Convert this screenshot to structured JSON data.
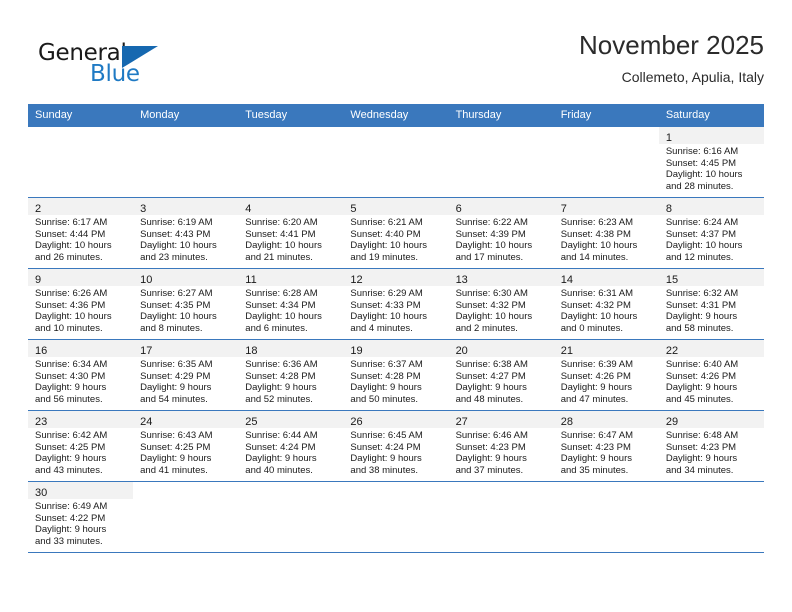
{
  "brand": {
    "name_top": "General",
    "name_bottom": "Blue",
    "accent_color": "#1668b0",
    "text_color": "#1a1a1a"
  },
  "header": {
    "title": "November 2025",
    "subtitle": "Collemeto, Apulia, Italy"
  },
  "theme": {
    "header_bg": "#3a78bd",
    "header_text": "#ffffff",
    "daynum_bg": "#f2f2f2",
    "grid_line": "#3a78bd"
  },
  "weekdays": [
    "Sunday",
    "Monday",
    "Tuesday",
    "Wednesday",
    "Thursday",
    "Friday",
    "Saturday"
  ],
  "labels": {
    "sunrise_prefix": "Sunrise:",
    "sunset_prefix": "Sunset:",
    "daylight_prefix": "Daylight:"
  },
  "weeks": [
    [
      {
        "day": "",
        "empty": true
      },
      {
        "day": "",
        "empty": true
      },
      {
        "day": "",
        "empty": true
      },
      {
        "day": "",
        "empty": true
      },
      {
        "day": "",
        "empty": true
      },
      {
        "day": "",
        "empty": true
      },
      {
        "day": "1",
        "sunrise": "Sunrise: 6:16 AM",
        "sunset": "Sunset: 4:45 PM",
        "daylight_line1": "Daylight: 10 hours",
        "daylight_line2": "and 28 minutes."
      }
    ],
    [
      {
        "day": "2",
        "sunrise": "Sunrise: 6:17 AM",
        "sunset": "Sunset: 4:44 PM",
        "daylight_line1": "Daylight: 10 hours",
        "daylight_line2": "and 26 minutes."
      },
      {
        "day": "3",
        "sunrise": "Sunrise: 6:19 AM",
        "sunset": "Sunset: 4:43 PM",
        "daylight_line1": "Daylight: 10 hours",
        "daylight_line2": "and 23 minutes."
      },
      {
        "day": "4",
        "sunrise": "Sunrise: 6:20 AM",
        "sunset": "Sunset: 4:41 PM",
        "daylight_line1": "Daylight: 10 hours",
        "daylight_line2": "and 21 minutes."
      },
      {
        "day": "5",
        "sunrise": "Sunrise: 6:21 AM",
        "sunset": "Sunset: 4:40 PM",
        "daylight_line1": "Daylight: 10 hours",
        "daylight_line2": "and 19 minutes."
      },
      {
        "day": "6",
        "sunrise": "Sunrise: 6:22 AM",
        "sunset": "Sunset: 4:39 PM",
        "daylight_line1": "Daylight: 10 hours",
        "daylight_line2": "and 17 minutes."
      },
      {
        "day": "7",
        "sunrise": "Sunrise: 6:23 AM",
        "sunset": "Sunset: 4:38 PM",
        "daylight_line1": "Daylight: 10 hours",
        "daylight_line2": "and 14 minutes."
      },
      {
        "day": "8",
        "sunrise": "Sunrise: 6:24 AM",
        "sunset": "Sunset: 4:37 PM",
        "daylight_line1": "Daylight: 10 hours",
        "daylight_line2": "and 12 minutes."
      }
    ],
    [
      {
        "day": "9",
        "sunrise": "Sunrise: 6:26 AM",
        "sunset": "Sunset: 4:36 PM",
        "daylight_line1": "Daylight: 10 hours",
        "daylight_line2": "and 10 minutes."
      },
      {
        "day": "10",
        "sunrise": "Sunrise: 6:27 AM",
        "sunset": "Sunset: 4:35 PM",
        "daylight_line1": "Daylight: 10 hours",
        "daylight_line2": "and 8 minutes."
      },
      {
        "day": "11",
        "sunrise": "Sunrise: 6:28 AM",
        "sunset": "Sunset: 4:34 PM",
        "daylight_line1": "Daylight: 10 hours",
        "daylight_line2": "and 6 minutes."
      },
      {
        "day": "12",
        "sunrise": "Sunrise: 6:29 AM",
        "sunset": "Sunset: 4:33 PM",
        "daylight_line1": "Daylight: 10 hours",
        "daylight_line2": "and 4 minutes."
      },
      {
        "day": "13",
        "sunrise": "Sunrise: 6:30 AM",
        "sunset": "Sunset: 4:32 PM",
        "daylight_line1": "Daylight: 10 hours",
        "daylight_line2": "and 2 minutes."
      },
      {
        "day": "14",
        "sunrise": "Sunrise: 6:31 AM",
        "sunset": "Sunset: 4:32 PM",
        "daylight_line1": "Daylight: 10 hours",
        "daylight_line2": "and 0 minutes."
      },
      {
        "day": "15",
        "sunrise": "Sunrise: 6:32 AM",
        "sunset": "Sunset: 4:31 PM",
        "daylight_line1": "Daylight: 9 hours",
        "daylight_line2": "and 58 minutes."
      }
    ],
    [
      {
        "day": "16",
        "sunrise": "Sunrise: 6:34 AM",
        "sunset": "Sunset: 4:30 PM",
        "daylight_line1": "Daylight: 9 hours",
        "daylight_line2": "and 56 minutes."
      },
      {
        "day": "17",
        "sunrise": "Sunrise: 6:35 AM",
        "sunset": "Sunset: 4:29 PM",
        "daylight_line1": "Daylight: 9 hours",
        "daylight_line2": "and 54 minutes."
      },
      {
        "day": "18",
        "sunrise": "Sunrise: 6:36 AM",
        "sunset": "Sunset: 4:28 PM",
        "daylight_line1": "Daylight: 9 hours",
        "daylight_line2": "and 52 minutes."
      },
      {
        "day": "19",
        "sunrise": "Sunrise: 6:37 AM",
        "sunset": "Sunset: 4:28 PM",
        "daylight_line1": "Daylight: 9 hours",
        "daylight_line2": "and 50 minutes."
      },
      {
        "day": "20",
        "sunrise": "Sunrise: 6:38 AM",
        "sunset": "Sunset: 4:27 PM",
        "daylight_line1": "Daylight: 9 hours",
        "daylight_line2": "and 48 minutes."
      },
      {
        "day": "21",
        "sunrise": "Sunrise: 6:39 AM",
        "sunset": "Sunset: 4:26 PM",
        "daylight_line1": "Daylight: 9 hours",
        "daylight_line2": "and 47 minutes."
      },
      {
        "day": "22",
        "sunrise": "Sunrise: 6:40 AM",
        "sunset": "Sunset: 4:26 PM",
        "daylight_line1": "Daylight: 9 hours",
        "daylight_line2": "and 45 minutes."
      }
    ],
    [
      {
        "day": "23",
        "sunrise": "Sunrise: 6:42 AM",
        "sunset": "Sunset: 4:25 PM",
        "daylight_line1": "Daylight: 9 hours",
        "daylight_line2": "and 43 minutes."
      },
      {
        "day": "24",
        "sunrise": "Sunrise: 6:43 AM",
        "sunset": "Sunset: 4:25 PM",
        "daylight_line1": "Daylight: 9 hours",
        "daylight_line2": "and 41 minutes."
      },
      {
        "day": "25",
        "sunrise": "Sunrise: 6:44 AM",
        "sunset": "Sunset: 4:24 PM",
        "daylight_line1": "Daylight: 9 hours",
        "daylight_line2": "and 40 minutes."
      },
      {
        "day": "26",
        "sunrise": "Sunrise: 6:45 AM",
        "sunset": "Sunset: 4:24 PM",
        "daylight_line1": "Daylight: 9 hours",
        "daylight_line2": "and 38 minutes."
      },
      {
        "day": "27",
        "sunrise": "Sunrise: 6:46 AM",
        "sunset": "Sunset: 4:23 PM",
        "daylight_line1": "Daylight: 9 hours",
        "daylight_line2": "and 37 minutes."
      },
      {
        "day": "28",
        "sunrise": "Sunrise: 6:47 AM",
        "sunset": "Sunset: 4:23 PM",
        "daylight_line1": "Daylight: 9 hours",
        "daylight_line2": "and 35 minutes."
      },
      {
        "day": "29",
        "sunrise": "Sunrise: 6:48 AM",
        "sunset": "Sunset: 4:23 PM",
        "daylight_line1": "Daylight: 9 hours",
        "daylight_line2": "and 34 minutes."
      }
    ],
    [
      {
        "day": "30",
        "sunrise": "Sunrise: 6:49 AM",
        "sunset": "Sunset: 4:22 PM",
        "daylight_line1": "Daylight: 9 hours",
        "daylight_line2": "and 33 minutes."
      },
      {
        "day": "",
        "empty": true
      },
      {
        "day": "",
        "empty": true
      },
      {
        "day": "",
        "empty": true
      },
      {
        "day": "",
        "empty": true
      },
      {
        "day": "",
        "empty": true
      },
      {
        "day": "",
        "empty": true
      }
    ]
  ]
}
